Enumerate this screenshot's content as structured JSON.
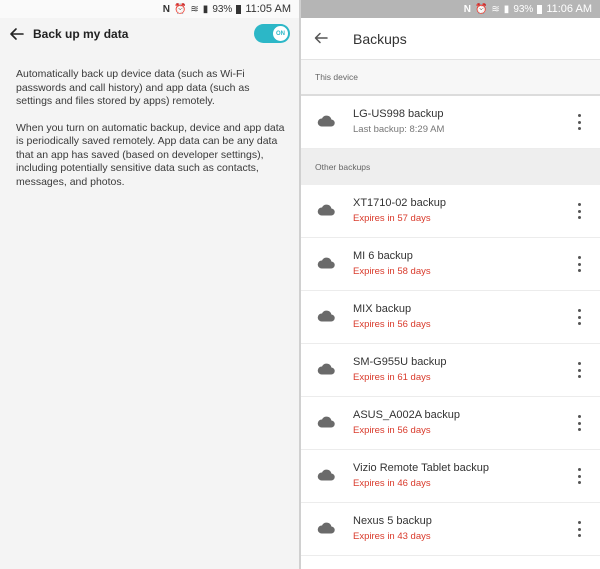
{
  "left_screen": {
    "status": {
      "nfc": "N",
      "alarm": "⏰",
      "wifi": "≋",
      "signal": "▮",
      "battery_pct": "93%",
      "time": "11:05 AM"
    },
    "title": "Back up my data",
    "toggle_label": "ON",
    "paragraphs": [
      "Automatically back up device data (such as Wi-Fi passwords and call history) and app data (such as settings and files stored by apps) remotely.",
      "When you turn on automatic backup, device and app data is periodically saved remotely. App data can be any data that an app has saved (based on developer settings), including potentially sensitive data such as contacts, messages, and photos."
    ]
  },
  "right_screen": {
    "status": {
      "nfc": "N",
      "alarm": "⏰",
      "wifi": "≋",
      "signal": "▮",
      "battery_pct": "93%",
      "time": "11:06 AM"
    },
    "title": "Backups",
    "this_device_label": "This device",
    "this_device": {
      "name": "LG-US998 backup",
      "detail": "Last backup: 8:29 AM"
    },
    "other_label": "Other backups",
    "other": [
      {
        "name": "XT1710-02 backup",
        "detail": "Expires in 57 days"
      },
      {
        "name": "MI 6 backup",
        "detail": "Expires in 58 days"
      },
      {
        "name": "MIX backup",
        "detail": "Expires in 56 days"
      },
      {
        "name": "SM-G955U backup",
        "detail": "Expires in 61 days"
      },
      {
        "name": "ASUS_A002A backup",
        "detail": "Expires in 56 days"
      },
      {
        "name": "Vizio Remote Tablet backup",
        "detail": "Expires in 46 days"
      },
      {
        "name": "Nexus 5 backup",
        "detail": "Expires in 43 days"
      }
    ]
  },
  "colors": {
    "toggle_on": "#2cb7c7",
    "expiry_red": "#d93a2b"
  }
}
